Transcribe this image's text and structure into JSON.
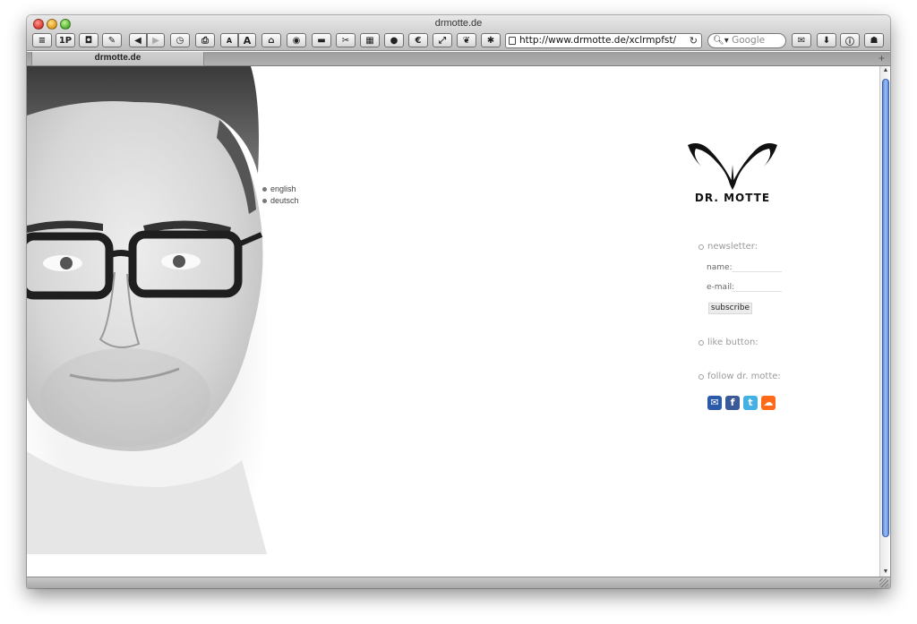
{
  "window": {
    "title": "drmotte.de",
    "url": "http://www.drmotte.de/xclrmpfst/",
    "search_placeholder": "Google",
    "tab_label": "drmotte.de",
    "tab_add": "+"
  },
  "toolbar": {
    "bookmarks_label": "1P",
    "text_small": "A",
    "text_large": "A",
    "euro": "€"
  },
  "page": {
    "languages": [
      "english",
      "deutsch"
    ],
    "logo_text": "DR. MOTTE",
    "newsletter": {
      "heading": "newsletter:",
      "name_label": "name:",
      "email_label": "e-mail:",
      "subscribe_label": "subscribe"
    },
    "like_heading": "like button:",
    "follow_heading": "follow dr. motte:",
    "social": [
      {
        "name": "myspace-icon",
        "glyph": "✉",
        "color": "#2a5aa8"
      },
      {
        "name": "facebook-icon",
        "glyph": "f",
        "color": "#3b5998"
      },
      {
        "name": "twitter-icon",
        "glyph": "t",
        "color": "#45b0e3"
      },
      {
        "name": "soundcloud-icon",
        "glyph": "☁",
        "color": "#ff6a1a"
      }
    ]
  }
}
